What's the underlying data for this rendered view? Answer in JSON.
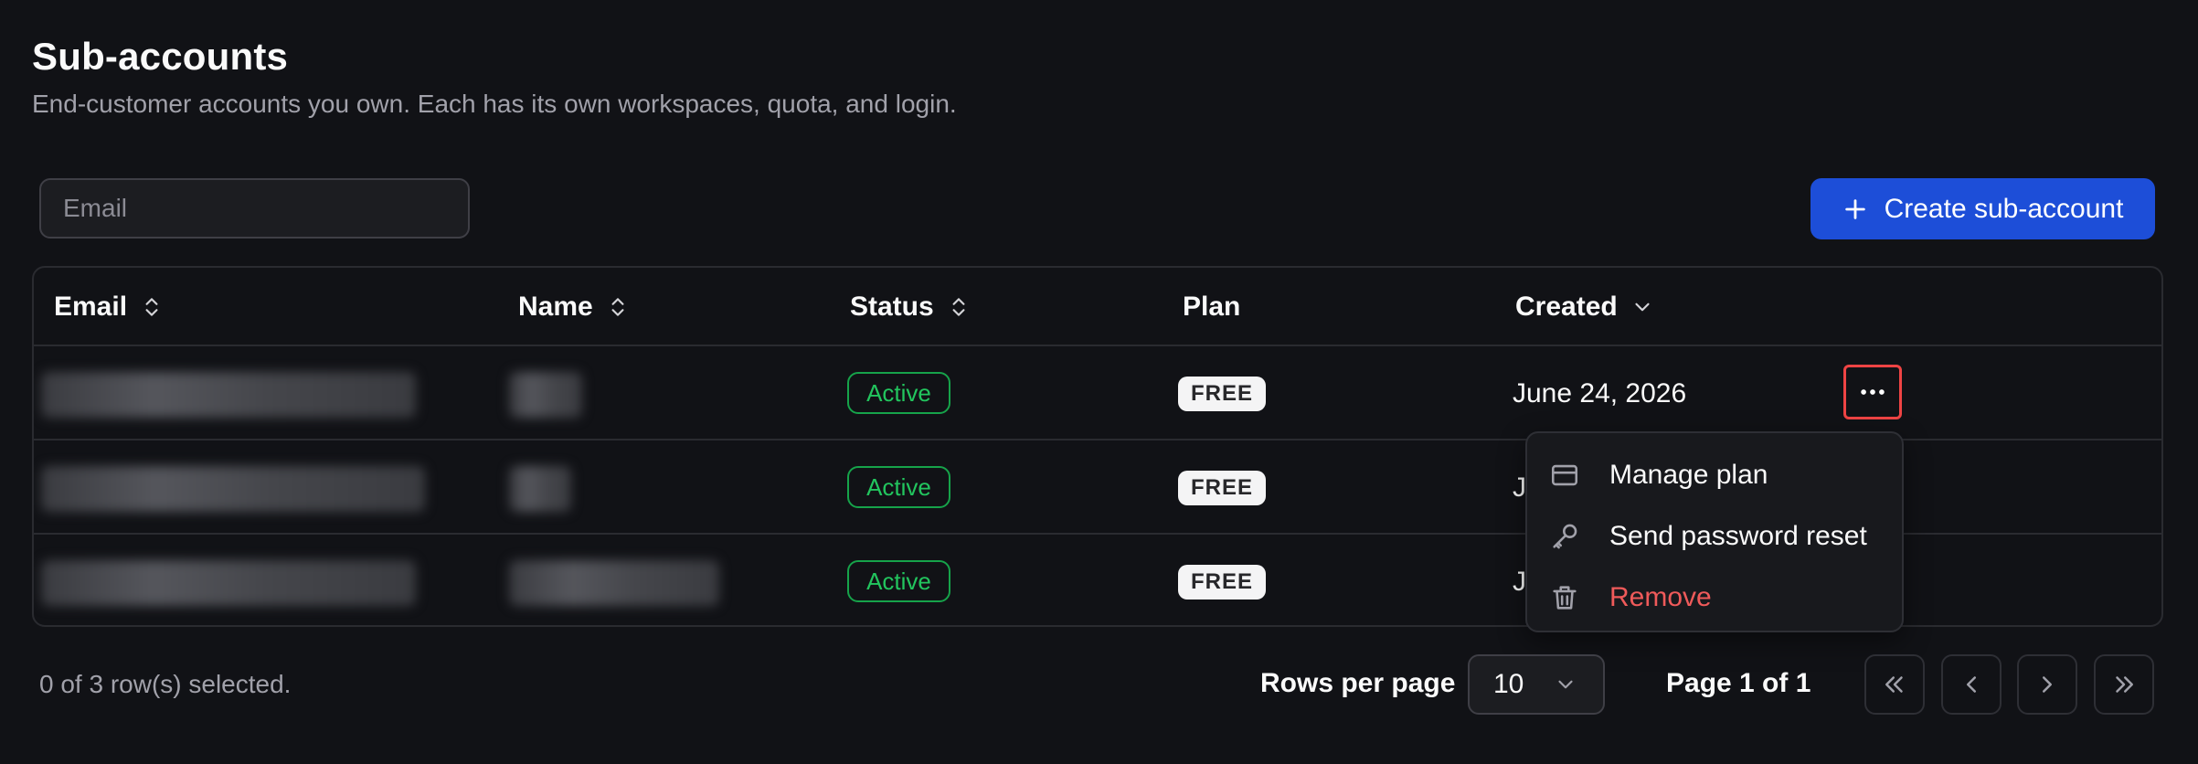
{
  "header": {
    "title": "Sub-accounts",
    "subtitle": "End-customer accounts you own. Each has its own workspaces, quota, and login."
  },
  "toolbar": {
    "search_placeholder": "Email",
    "search_value": "",
    "create_label": "Create sub-account"
  },
  "table": {
    "columns": [
      {
        "label": "Email",
        "sort": "unsorted"
      },
      {
        "label": "Name",
        "sort": "unsorted"
      },
      {
        "label": "Status",
        "sort": "unsorted"
      },
      {
        "label": "Plan",
        "sort": "none"
      },
      {
        "label": "Created",
        "sort": "descending"
      }
    ],
    "rows": [
      {
        "email": "[redacted]",
        "name": "[redacted]",
        "status": "Active",
        "plan": "FREE",
        "created": "June 24, 2026"
      },
      {
        "email": "[redacted]",
        "name": "[redacted]",
        "status": "Active",
        "plan": "FREE",
        "created": "J"
      },
      {
        "email": "[redacted]",
        "name": "[redacted]",
        "status": "Active",
        "plan": "FREE",
        "created": "J"
      }
    ]
  },
  "row_menu": {
    "items": [
      {
        "label": "Manage plan",
        "icon": "credit-card-icon"
      },
      {
        "label": "Send password reset",
        "icon": "key-icon"
      },
      {
        "label": "Remove",
        "icon": "trash-icon"
      }
    ]
  },
  "footer": {
    "selection": "0 of 3 row(s) selected.",
    "rows_per_page_label": "Rows per page",
    "rows_per_page_value": "10",
    "page_info": "Page 1 of 1"
  },
  "colors": {
    "background": "#111216",
    "primary": "#1d4ed8",
    "active": "#22c55e",
    "danger": "#ef5a5a",
    "highlight": "#ef4444"
  },
  "icons": {
    "create": "plus-icon",
    "sort_unsorted": "sort-icon",
    "sort_desc": "chevron-down-icon",
    "row_actions": "more-horizontal-icon",
    "pagination": [
      "chevrons-left-icon",
      "chevron-left-icon",
      "chevron-right-icon",
      "chevrons-right-icon"
    ]
  }
}
